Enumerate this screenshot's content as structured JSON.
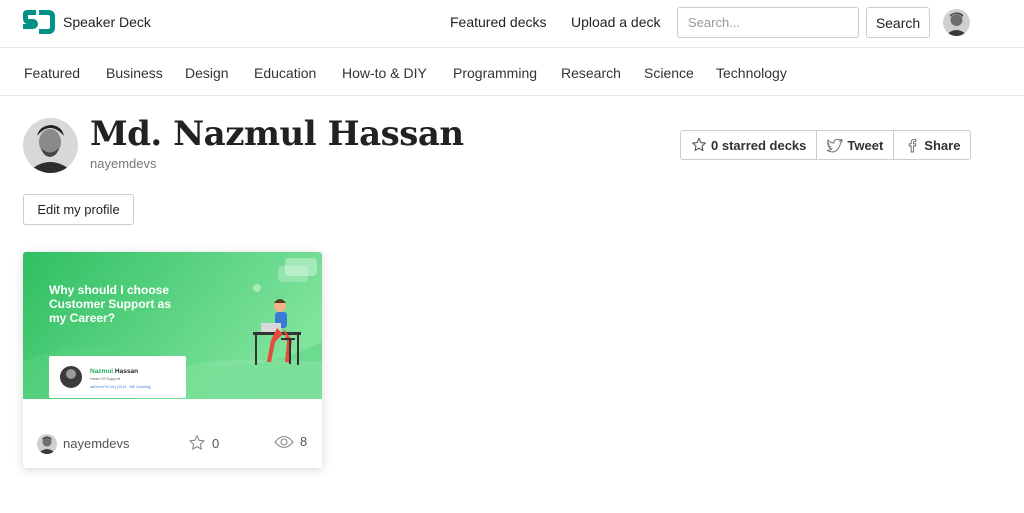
{
  "header": {
    "brand": "Speaker Deck",
    "nav": {
      "featured": "Featured decks",
      "upload": "Upload a deck"
    },
    "search": {
      "placeholder": "Search...",
      "button": "Search"
    }
  },
  "categories": [
    "Featured",
    "Business",
    "Design",
    "Education",
    "How-to & DIY",
    "Programming",
    "Research",
    "Science",
    "Technology"
  ],
  "profile": {
    "name": "Md. Nazmul Hassan",
    "handle": "nayemdevs",
    "edit_label": "Edit my profile",
    "actions": {
      "starred": "0 starred decks",
      "tweet": "Tweet",
      "share": "Share"
    }
  },
  "deck": {
    "title_line1": "Why should I choose",
    "title_line2": "Customer Support as",
    "title_line3": "my Career?",
    "speaker_first": "Nazmul",
    "speaker_last": " Hassan",
    "speaker_role": "Head Of Support",
    "speaker_meta": "weDevs Pvt Ltd  |  (2014 - Still Counting)",
    "owner": "nayemdevs",
    "stars": "0",
    "views": "8"
  },
  "colors": {
    "brand": "#009287",
    "thumb_start": "#2fbf62",
    "thumb_end": "#8ae8a5"
  }
}
